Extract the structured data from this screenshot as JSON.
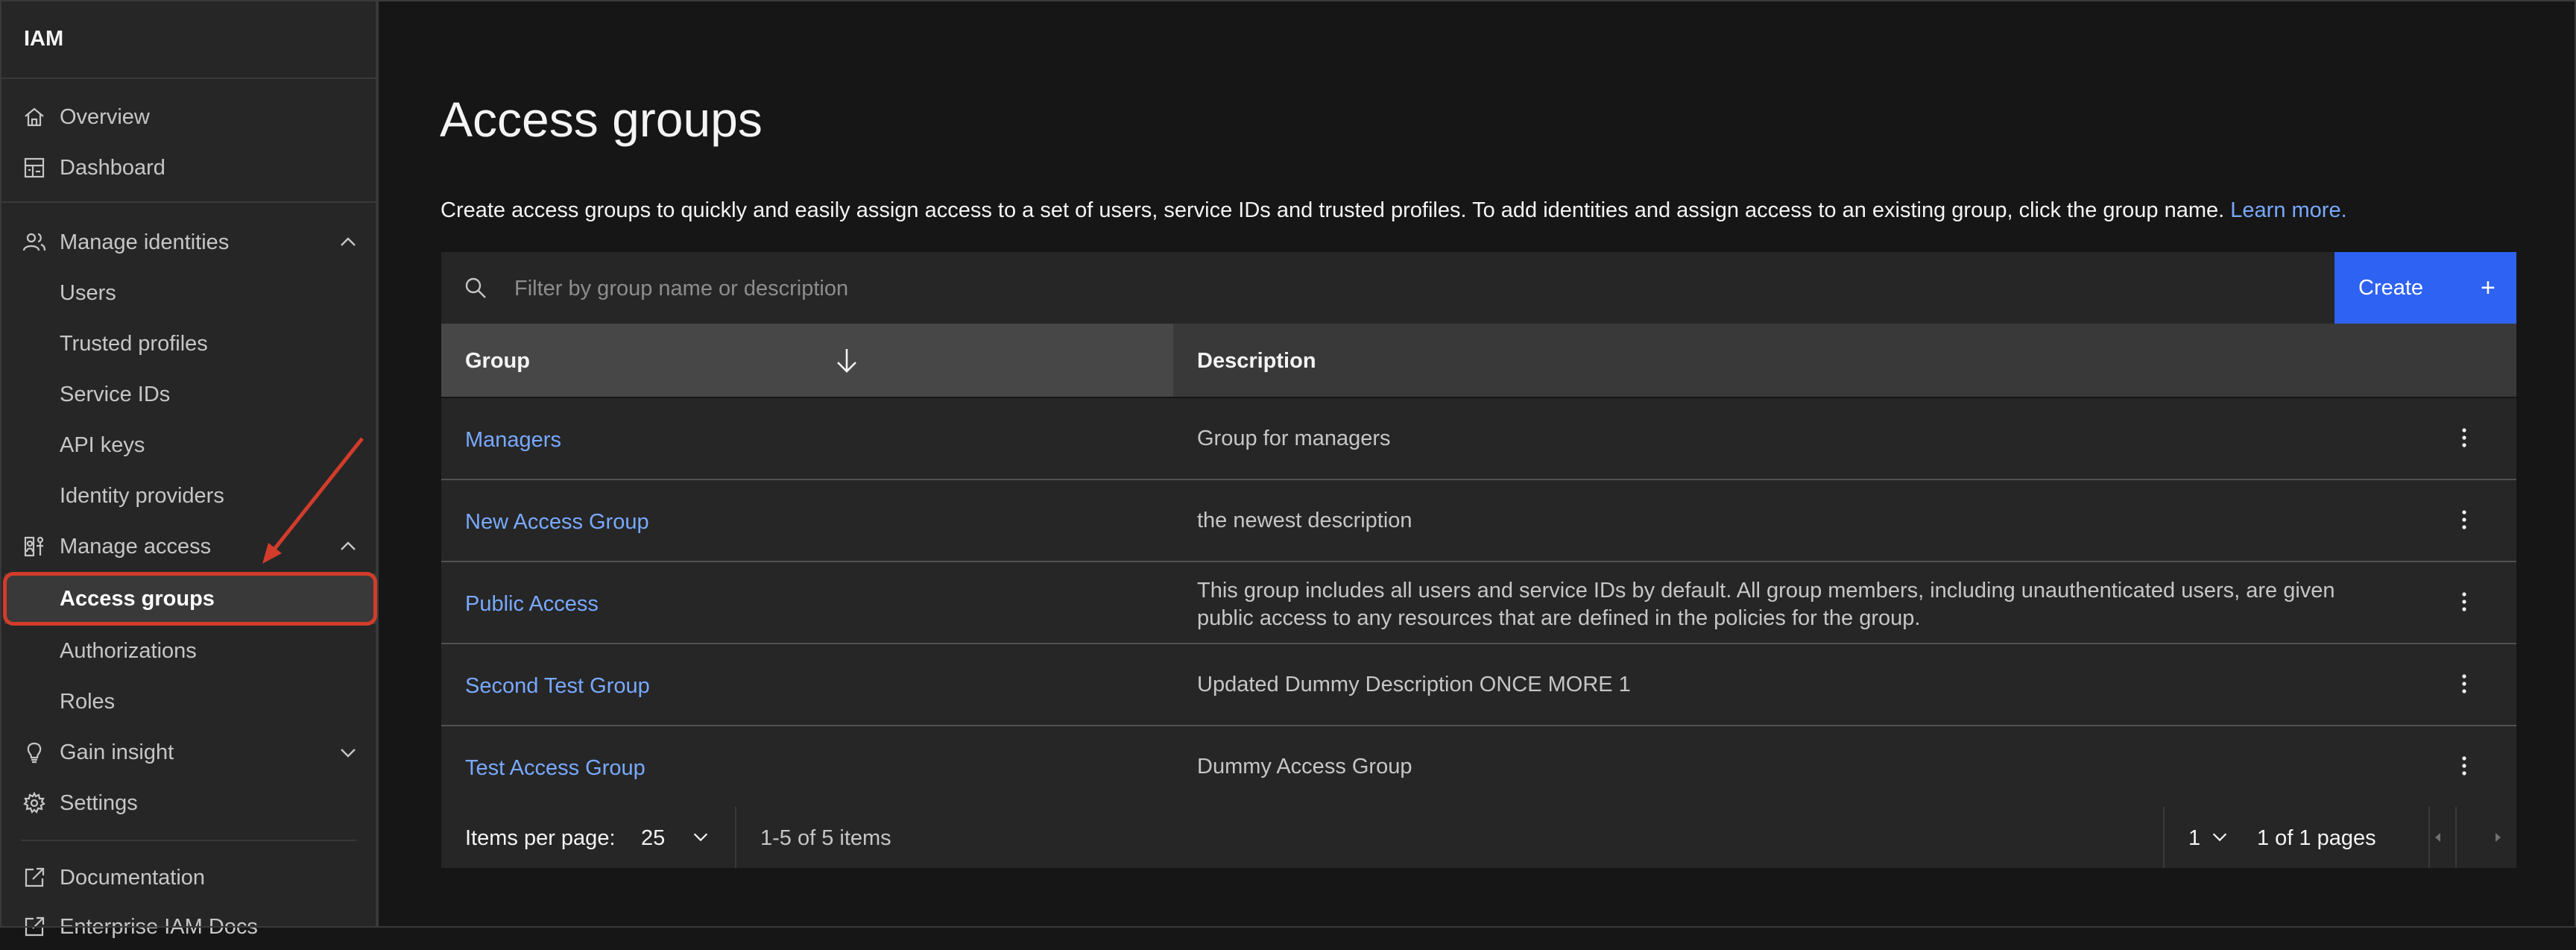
{
  "sidebar": {
    "title": "IAM",
    "items": [
      {
        "label": "Overview",
        "icon": "home-icon"
      },
      {
        "label": "Dashboard",
        "icon": "dashboard-icon"
      },
      {
        "label": "Manage identities",
        "icon": "users-icon",
        "expanded": true
      },
      {
        "label": "Users"
      },
      {
        "label": "Trusted profiles"
      },
      {
        "label": "Service IDs"
      },
      {
        "label": "API keys"
      },
      {
        "label": "Identity providers"
      },
      {
        "label": "Manage access",
        "icon": "access-icon",
        "expanded": true
      },
      {
        "label": "Access groups",
        "active": true
      },
      {
        "label": "Authorizations"
      },
      {
        "label": "Roles"
      },
      {
        "label": "Gain insight",
        "icon": "lightbulb-icon",
        "expanded": false
      },
      {
        "label": "Settings",
        "icon": "gear-icon"
      },
      {
        "label": "Documentation",
        "icon": "launch-icon"
      },
      {
        "label": "Enterprise IAM Docs",
        "icon": "launch-icon"
      }
    ]
  },
  "main": {
    "title": "Access groups",
    "description": "Create access groups to quickly and easily assign access to a set of users, service IDs and trusted profiles. To add identities and assign access to an existing group, click the group name.",
    "learn_more": "Learn more.",
    "search_placeholder": "Filter by group name or description",
    "create_label": "Create",
    "create_icon": "plus-icon"
  },
  "table": {
    "columns": [
      "Group",
      "Description"
    ],
    "sort": "descending",
    "rows": [
      {
        "name": "Managers",
        "description": "Group for managers"
      },
      {
        "name": "New Access Group",
        "description": "the newest description"
      },
      {
        "name": "Public Access",
        "description": "This group includes all users and service IDs by default. All group members, including unauthenticated users, are given public access to any resources that are defined in the policies for the group."
      },
      {
        "name": "Second Test Group",
        "description": "Updated Dummy Description ONCE MORE 1"
      },
      {
        "name": "Test Access Group",
        "description": "Dummy Access Group"
      }
    ]
  },
  "pagination": {
    "items_per_page_label": "Items per page:",
    "items_per_page": "25",
    "range": "1-5 of 5 items",
    "page": "1",
    "pages_text": "1 of 1 pages"
  },
  "colors": {
    "background": "#161616",
    "panel": "#262626",
    "accent": "#2e62f2",
    "link": "#78a9ff",
    "annotation": "#d23c2a"
  }
}
